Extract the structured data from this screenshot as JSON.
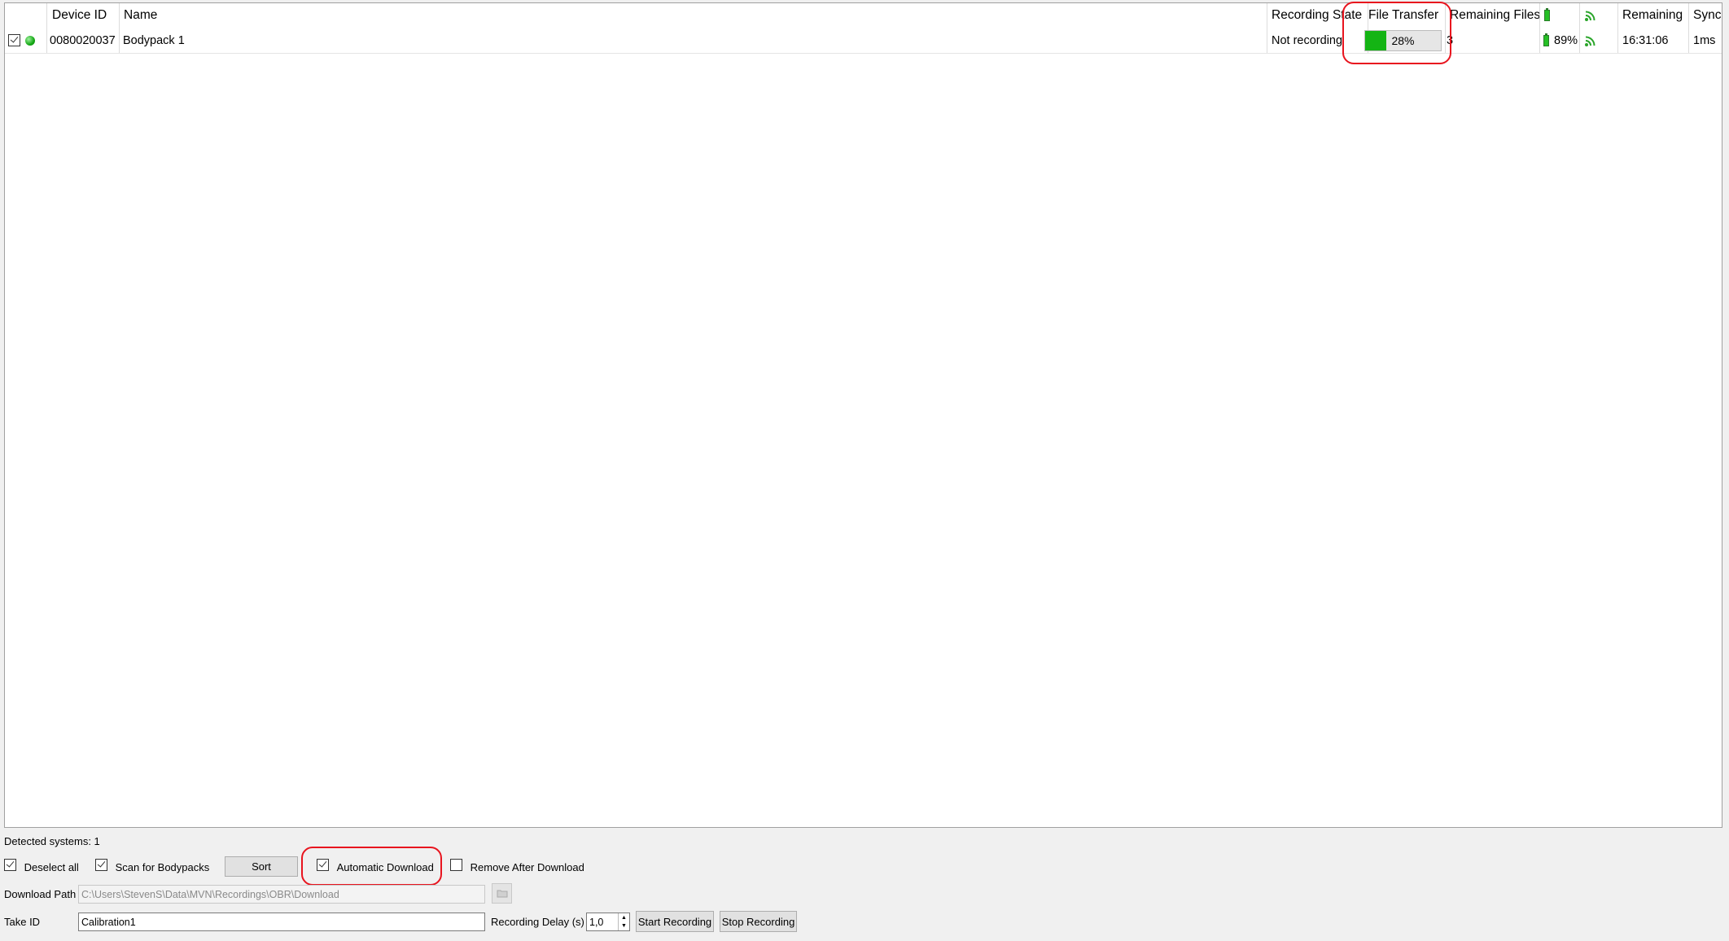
{
  "table": {
    "headers": {
      "device_id": "Device ID",
      "name": "Name",
      "recording_state": "Recording State",
      "file_transfer": "File Transfer",
      "remaining_files": "Remaining Files",
      "battery_icon": "battery-icon",
      "signal_icon": "signal-icon",
      "remaining": "Remaining",
      "sync": "Sync"
    },
    "rows": [
      {
        "checked": true,
        "status_icon": "status-dot-icon",
        "device_id": "0080020037",
        "name": "Bodypack 1",
        "recording_state": "Not recording",
        "file_transfer_percent": 28,
        "file_transfer_label": "28%",
        "remaining_files": "3",
        "battery": "89%",
        "remaining": "16:31:06",
        "sync": "1ms"
      }
    ]
  },
  "footer": {
    "detected_systems": "Detected systems: 1",
    "deselect_all": "Deselect all",
    "scan_for_bodypacks": "Scan for Bodypacks",
    "sort": "Sort",
    "automatic_download": "Automatic Download",
    "remove_after_download": "Remove After Download",
    "download_path_label": "Download Path",
    "download_path_value": "C:\\Users\\StevenS\\Data\\MVN\\Recordings\\OBR\\Download",
    "folder_icon": "folder-icon",
    "take_id_label": "Take ID",
    "take_id_value": "Calibration1",
    "recording_delay_label": "Recording Delay (s)",
    "recording_delay_value": "1,0",
    "start_recording": "Start Recording",
    "stop_recording": "Stop Recording"
  },
  "colors": {
    "annotation": "#e8141e",
    "progress_fill": "#14b414",
    "status_green": "#14a814"
  }
}
